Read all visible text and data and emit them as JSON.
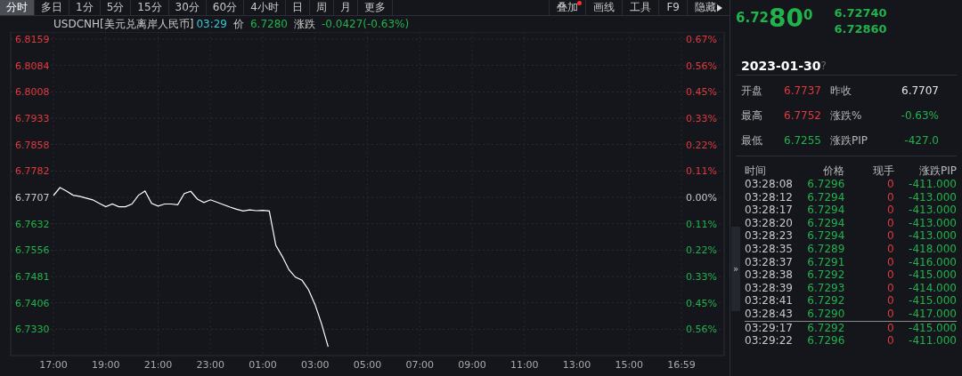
{
  "period_tabs": [
    {
      "label": "分时",
      "selected": true
    },
    {
      "label": "多日",
      "selected": false
    },
    {
      "label": "1分",
      "selected": false
    },
    {
      "label": "5分",
      "selected": false
    },
    {
      "label": "15分",
      "selected": false
    },
    {
      "label": "30分",
      "selected": false
    },
    {
      "label": "60分",
      "selected": false
    },
    {
      "label": "4小时",
      "selected": false
    },
    {
      "label": "日",
      "selected": false
    },
    {
      "label": "周",
      "selected": false
    },
    {
      "label": "月",
      "selected": false
    },
    {
      "label": "更多",
      "selected": false
    }
  ],
  "tools": [
    {
      "label": "叠加",
      "notification": true,
      "kind": "plain"
    },
    {
      "label": "画线",
      "notification": false,
      "kind": "plain"
    },
    {
      "label": "工具",
      "notification": false,
      "kind": "plain"
    },
    {
      "label": "F9",
      "notification": false,
      "kind": "plain"
    },
    {
      "label": "隐藏",
      "notification": false,
      "kind": "collapse"
    }
  ],
  "info": {
    "time": "03:29",
    "price_label": "价",
    "price": "6.7280",
    "change_label": "涨跌",
    "change": "-0.0427(-0.63%)"
  },
  "chart": {
    "percent_ticks": [
      {
        "label": "0.67%",
        "color": "#e03a3e"
      },
      {
        "label": "0.56%",
        "color": "#e03a3e"
      },
      {
        "label": "0.45%",
        "color": "#e03a3e"
      },
      {
        "label": "0.33%",
        "color": "#e03a3e"
      },
      {
        "label": "0.22%",
        "color": "#e03a3e"
      },
      {
        "label": "0.11%",
        "color": "#e03a3e"
      },
      {
        "label": "0.00%",
        "color": "#c8c8c8"
      },
      {
        "label": "0.11%",
        "color": "#22b24c"
      },
      {
        "label": "0.22%",
        "color": "#22b24c"
      },
      {
        "label": "0.33%",
        "color": "#22b24c"
      },
      {
        "label": "0.45%",
        "color": "#22b24c"
      },
      {
        "label": "0.56%",
        "color": "#22b24c"
      }
    ],
    "chart_data": {
      "type": "line",
      "grid": true,
      "ylim": [
        6.7255,
        6.8159
      ],
      "categories": [
        "17:00",
        null,
        null,
        null,
        null,
        null,
        null,
        null,
        "19:00",
        null,
        null,
        null,
        null,
        null,
        null,
        null,
        "21:00",
        null,
        null,
        null,
        null,
        null,
        null,
        null,
        "23:00",
        null,
        null,
        null,
        null,
        null,
        null,
        null,
        "01:00",
        null,
        null,
        null,
        null,
        null,
        null,
        null,
        "03:00",
        null,
        null,
        null,
        null,
        null,
        null,
        null,
        "05:00",
        null,
        null,
        null,
        null,
        null,
        null,
        null,
        "07:00",
        null,
        null,
        null,
        null,
        null,
        null,
        null,
        "09:00",
        null,
        null,
        null,
        null,
        null,
        null,
        null,
        "11:00",
        null,
        null,
        null,
        null,
        null,
        null,
        null,
        "13:00",
        null,
        null,
        null,
        null,
        null,
        null,
        null,
        "15:00",
        null,
        null,
        null,
        null,
        null,
        null,
        null,
        "16:59"
      ],
      "yticks": [
        {
          "value": 6.8159,
          "label": "6.8159"
        },
        {
          "value": 6.8084,
          "label": "6.8084"
        },
        {
          "value": 6.8008,
          "label": "6.8008"
        },
        {
          "value": 6.7933,
          "label": "6.7933"
        },
        {
          "value": 6.7858,
          "label": "6.7858"
        },
        {
          "value": 6.7782,
          "label": "6.7782"
        },
        {
          "value": 6.7707,
          "label": "6.7707"
        },
        {
          "value": 6.7632,
          "label": "6.7632"
        },
        {
          "value": 6.7556,
          "label": "6.7556"
        },
        {
          "value": 6.7481,
          "label": "6.7481"
        },
        {
          "value": 6.7406,
          "label": "6.7406"
        },
        {
          "value": 6.733,
          "label": "6.7330"
        }
      ],
      "series": [
        {
          "name": "USDCNH[美元兑离岸人民币]",
          "color": "#ffffff",
          "values": [
            6.7712,
            6.7735,
            6.7725,
            6.7713,
            6.771,
            6.7705,
            6.77,
            6.769,
            6.768,
            6.7688,
            6.768,
            6.768,
            6.7688,
            6.7713,
            6.7725,
            6.769,
            6.7682,
            6.7688,
            6.7688,
            6.7686,
            6.7718,
            6.7724,
            6.7702,
            6.7692,
            6.77,
            6.7693,
            6.7686,
            6.7679,
            6.7673,
            6.7668,
            6.7671,
            6.7669,
            6.767,
            6.7668,
            6.757,
            6.7538,
            6.75,
            6.7479,
            6.747,
            6.7443,
            6.74,
            6.7345,
            6.728,
            null,
            null,
            null,
            null,
            null,
            null,
            null,
            null,
            null,
            null,
            null,
            null,
            null,
            null,
            null,
            null,
            null,
            null,
            null,
            null,
            null,
            null,
            null,
            null,
            null,
            null,
            null,
            null,
            null,
            null,
            null,
            null,
            null,
            null,
            null,
            null,
            null,
            null,
            null,
            null,
            null,
            null,
            null,
            null,
            null,
            null,
            null,
            null,
            null,
            null,
            null,
            null,
            null,
            null
          ]
        }
      ]
    }
  },
  "quote": {
    "price_prefix": "6.72",
    "price_main": "80",
    "price_suffix": "0",
    "bid": "6.72740",
    "ask": "6.72860"
  },
  "date": "2023-01-30",
  "help_icon": "?",
  "collapse_handle": "»",
  "stats": [
    {
      "label": "开盘",
      "value": "6.7737",
      "color": "#e03a3e"
    },
    {
      "label": "昨收",
      "value": "6.7707",
      "color": "#e6e6e6"
    },
    {
      "label": "最高",
      "value": "6.7752",
      "color": "#e03a3e"
    },
    {
      "label": "涨跌%",
      "value": "-0.63%",
      "color": "#22b24c"
    },
    {
      "label": "最低",
      "value": "6.7255",
      "color": "#22b24c"
    },
    {
      "label": "涨跌PIP",
      "value": "-427.0",
      "color": "#22b24c"
    }
  ],
  "trades": {
    "columns": [
      "时间",
      "价格",
      "现手",
      "涨跌PIP"
    ],
    "rows": [
      {
        "time": "03:28:08",
        "price": "6.7296",
        "volume": "0",
        "change": "-411.000",
        "divider_above": false
      },
      {
        "time": "03:28:12",
        "price": "6.7294",
        "volume": "0",
        "change": "-413.000",
        "divider_above": false
      },
      {
        "time": "03:28:17",
        "price": "6.7294",
        "volume": "0",
        "change": "-413.000",
        "divider_above": false
      },
      {
        "time": "03:28:20",
        "price": "6.7294",
        "volume": "0",
        "change": "-413.000",
        "divider_above": false
      },
      {
        "time": "03:28:23",
        "price": "6.7294",
        "volume": "0",
        "change": "-413.000",
        "divider_above": false
      },
      {
        "time": "03:28:35",
        "price": "6.7289",
        "volume": "0",
        "change": "-418.000",
        "divider_above": false
      },
      {
        "time": "03:28:37",
        "price": "6.7291",
        "volume": "0",
        "change": "-416.000",
        "divider_above": false
      },
      {
        "time": "03:28:38",
        "price": "6.7292",
        "volume": "0",
        "change": "-415.000",
        "divider_above": false
      },
      {
        "time": "03:28:39",
        "price": "6.7293",
        "volume": "0",
        "change": "-414.000",
        "divider_above": false
      },
      {
        "time": "03:28:41",
        "price": "6.7292",
        "volume": "0",
        "change": "-415.000",
        "divider_above": false
      },
      {
        "time": "03:28:43",
        "price": "6.7290",
        "volume": "0",
        "change": "-417.000",
        "divider_above": false
      },
      {
        "time": "03:29:17",
        "price": "6.7292",
        "volume": "0",
        "change": "-415.000",
        "divider_above": true
      },
      {
        "time": "03:29:22",
        "price": "6.7296",
        "volume": "0",
        "change": "-411.000",
        "divider_above": false
      }
    ]
  }
}
